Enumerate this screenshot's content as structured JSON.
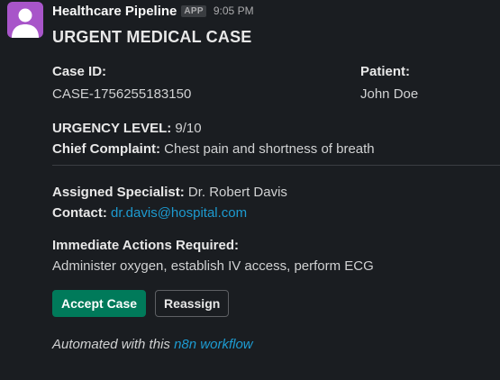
{
  "message": {
    "sender": "Healthcare Pipeline",
    "app_badge": "APP",
    "timestamp": "9:05 PM",
    "title": "URGENT MEDICAL CASE",
    "case_id_label": "Case ID:",
    "case_id_value": "CASE-1756255183150",
    "patient_label": "Patient:",
    "patient_value": "John Doe",
    "urgency_label": "URGENCY LEVEL:",
    "urgency_value": " 9/10",
    "complaint_label": "Chief Complaint:",
    "complaint_value": " Chest pain and shortness of breath",
    "specialist_label": "Assigned Specialist:",
    "specialist_value": " Dr. Robert Davis",
    "contact_label": "Contact:",
    "contact_email": "dr.davis@hospital.com",
    "actions_label": "Immediate Actions Required:",
    "actions_value": "Administer oxygen, establish IV access, perform ECG",
    "accept_button": "Accept Case",
    "reassign_button": "Reassign",
    "footer_prefix": "Automated with this ",
    "footer_link": "n8n workflow"
  },
  "colors": {
    "background": "#1a1d21",
    "avatar": "#a855c9",
    "accept_button": "#007a5a",
    "link": "#1d9bd1"
  },
  "icons": {
    "avatar": "user-avatar-icon"
  }
}
